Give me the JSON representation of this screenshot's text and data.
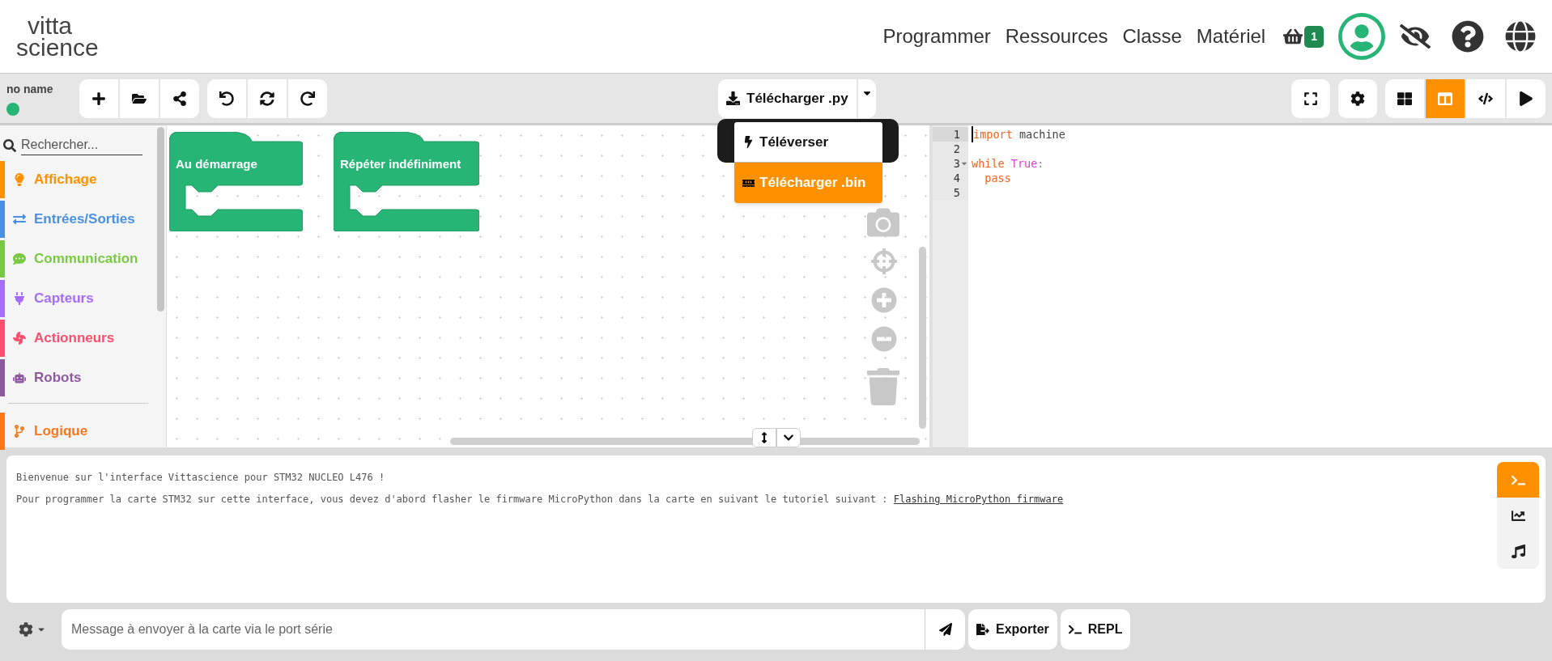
{
  "header": {
    "logo": [
      "vitta",
      "science"
    ],
    "nav": [
      "Programmer",
      "Ressources",
      "Classe",
      "Matériel"
    ],
    "cart_count": "1"
  },
  "toolbar": {
    "project_name": "no name",
    "connected": true,
    "download_button": "Télécharger .py",
    "views": [
      {
        "kind": "blocks",
        "selected": false
      },
      {
        "kind": "hybrid",
        "selected": true
      },
      {
        "kind": "code",
        "selected": false
      }
    ]
  },
  "download_menu": {
    "items": [
      {
        "kind": "upload",
        "label": "Téléverser",
        "selected": false
      },
      {
        "kind": "bin",
        "label": "Télécharger .bin",
        "selected": true
      }
    ]
  },
  "sidebar": {
    "search_placeholder": "Rechercher...",
    "category_groups": [
      {
        "categories": [
          {
            "kind": "display",
            "label": "Affichage",
            "color": "#ff9100"
          },
          {
            "kind": "io",
            "label": "Entrées/Sorties",
            "color": "#4a90e2"
          },
          {
            "kind": "communication",
            "label": "Communication",
            "color": "#7ac943"
          },
          {
            "kind": "sensors",
            "label": "Capteurs",
            "color": "#a56cff"
          },
          {
            "kind": "actuators",
            "label": "Actionneurs",
            "color": "#ff4d6d"
          },
          {
            "kind": "robots",
            "label": "Robots",
            "color": "#8e5a9e"
          }
        ]
      },
      {
        "categories": [
          {
            "kind": "logic",
            "label": "Logique",
            "color": "#ff7518"
          }
        ]
      }
    ]
  },
  "workspace": {
    "blocks": [
      {
        "label": "Au démarrage"
      },
      {
        "label": "Répéter indéfiniment"
      }
    ]
  },
  "editor": {
    "lines": [
      {
        "number": "1",
        "active": true,
        "foldable": false,
        "tokens": [
          {
            "kind": "keyword",
            "text": "import"
          },
          {
            "kind": "plain",
            "text": " machine"
          }
        ]
      },
      {
        "number": "2",
        "active": false,
        "foldable": false
      },
      {
        "number": "3",
        "active": false,
        "foldable": true,
        "tokens": [
          {
            "kind": "keyword",
            "text": "while"
          },
          {
            "kind": "constant",
            "text": " True"
          },
          {
            "kind": "punct",
            "text": ":"
          }
        ]
      },
      {
        "number": "4",
        "active": false,
        "foldable": false,
        "tokens": [
          {
            "kind": "keyword",
            "text": "  pass"
          }
        ]
      },
      {
        "number": "5",
        "active": false,
        "foldable": false
      }
    ]
  },
  "console": {
    "lines": [
      {
        "text": "Bienvenue sur l'interface Vittascience pour STM32 NUCLEO L476 !"
      },
      {
        "text": "Pour programmer la carte STM32 sur cette interface, vous devez d'abord flasher le firmware MicroPython dans la carte en suivant le tutoriel suivant : ",
        "link": "Flashing MicroPython firmware"
      }
    ],
    "tabs": [
      {
        "kind": "terminal",
        "selected": true
      },
      {
        "kind": "plotter",
        "selected": false
      },
      {
        "kind": "music",
        "selected": false
      }
    ],
    "input_placeholder": "Message à envoyer à la carte via le port série",
    "buttons": [
      {
        "kind": "export",
        "label": "Exporter"
      },
      {
        "kind": "repl",
        "label": "REPL"
      }
    ]
  }
}
